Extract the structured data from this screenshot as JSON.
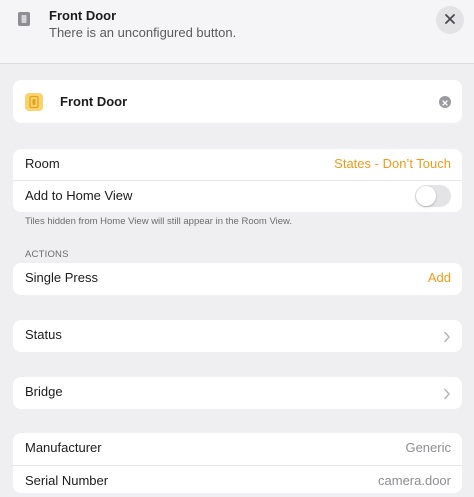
{
  "header": {
    "title": "Front Door",
    "subtitle": "There is an unconfigured button.",
    "icon": "button-device-icon",
    "close_icon": "close-icon"
  },
  "device": {
    "name": "Front Door",
    "icon": "button-device-icon",
    "clear_icon": "clear-icon"
  },
  "settings": {
    "room_label": "Room",
    "room_value": "States - Don’t Touch",
    "home_view_label": "Add to Home View",
    "home_view_enabled": false,
    "note": "Tiles hidden from Home View will still appear in the Room View."
  },
  "actions": {
    "section_title": "ACTIONS",
    "single_press_label": "Single Press",
    "add_label": "Add"
  },
  "status": {
    "label": "Status"
  },
  "bridge": {
    "label": "Bridge"
  },
  "info": {
    "manufacturer_label": "Manufacturer",
    "manufacturer_value": "Generic",
    "serial_label": "Serial Number",
    "serial_value": "camera.door"
  },
  "colors": {
    "accent": "#f09a1a",
    "background": "#efeff1",
    "card": "#ffffff",
    "icon_yellow": "#fbd36b"
  }
}
